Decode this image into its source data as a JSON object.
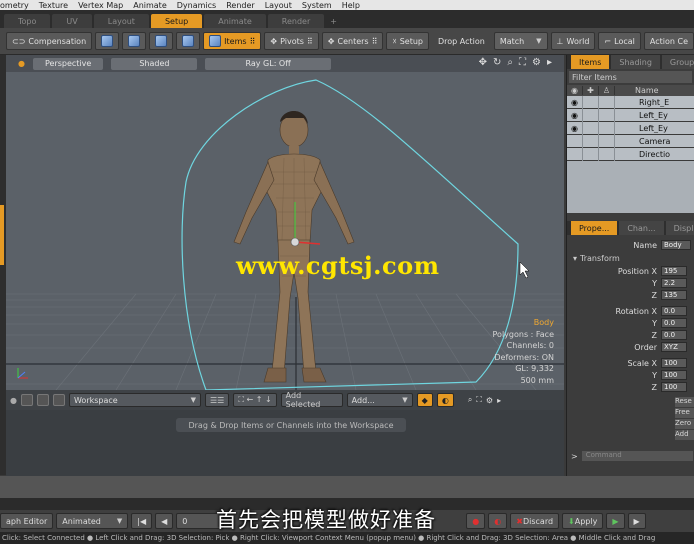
{
  "menu": [
    "ometry",
    "Texture",
    "Vertex Map",
    "Animate",
    "Dynamics",
    "Render",
    "Layout",
    "System",
    "Help"
  ],
  "tabs": [
    {
      "label": "Topo",
      "active": false
    },
    {
      "label": "UV",
      "active": false
    },
    {
      "label": "Layout",
      "active": false
    },
    {
      "label": "Setup",
      "active": true
    },
    {
      "label": "Animate",
      "active": false
    },
    {
      "label": "Render",
      "active": false
    },
    {
      "label": "+",
      "active": false
    }
  ],
  "toolbar": {
    "compensation": "Compensation",
    "items": "Items",
    "pivots": "Pivots",
    "centers": "Centers",
    "setup": "Setup",
    "drop_action_label": "Drop Action",
    "drop_action_value": "Match",
    "world": "World",
    "local": "Local",
    "action_center": "Action Ce"
  },
  "viewport": {
    "view": "Perspective",
    "shading": "Shaded",
    "raygl": "Ray GL: Off",
    "info": {
      "selected": "Body",
      "polygons": "Polygons : Face",
      "channels": "Channels: 0",
      "deformers": "Deformers: ON",
      "gl": "GL: 9,332",
      "scale": "500 mm"
    },
    "watermark": "www.cgtsj.com"
  },
  "workspace": {
    "dropdown": "Workspace",
    "add_selected": "Add Selected",
    "add": "Add...",
    "hint": "Drag & Drop Items or Channels into the Workspace"
  },
  "items_panel": {
    "tabs": [
      "Items",
      "Shading",
      "Group"
    ],
    "filter": "Filter Items",
    "name_header": "Name",
    "rows": [
      "Right_E",
      "Left_Ey",
      "Left_Ey",
      "Camera",
      "Directio"
    ]
  },
  "props_panel": {
    "tabs": [
      "Prope...",
      "Chan...",
      "Displ"
    ],
    "name_label": "Name",
    "name_value": "Body",
    "section": "Transform",
    "rows": [
      {
        "label": "Position X",
        "value": "195"
      },
      {
        "label": "Y",
        "value": "2.2"
      },
      {
        "label": "Z",
        "value": "135"
      },
      {
        "label": "Rotation X",
        "value": "0.0"
      },
      {
        "label": "Y",
        "value": "0.0"
      },
      {
        "label": "Z",
        "value": "0.0"
      },
      {
        "label": "Order",
        "value": "XYZ"
      },
      {
        "label": "Scale X",
        "value": "100"
      },
      {
        "label": "Y",
        "value": "100"
      },
      {
        "label": "Z",
        "value": "100"
      }
    ],
    "side_buttons": [
      "Rese",
      "Free",
      "Zero",
      "Add"
    ],
    "command": "Command"
  },
  "transport": {
    "graph_editor": "aph Editor",
    "animated": "Animated",
    "frame": "0",
    "discard": "Discard",
    "apply": "Apply"
  },
  "subtitle": "首先会把模型做好准备",
  "status": "Click: Select Connected ● Left Click and Drag: 3D Selection: Pick ● Right Click: Viewport Context Menu (popup menu) ● Right Click and Drag: 3D Selection: Area ● Middle Click and Drag"
}
